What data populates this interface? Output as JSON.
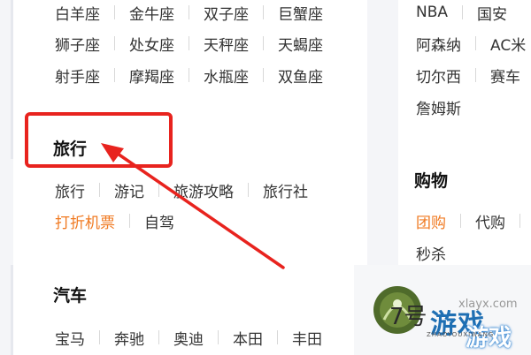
{
  "left": {
    "zodiac_rows": [
      [
        "白羊座",
        "金牛座",
        "双子座",
        "巨蟹座"
      ],
      [
        "狮子座",
        "处女座",
        "天秤座",
        "天蝎座"
      ],
      [
        "射手座",
        "摩羯座",
        "水瓶座",
        "双鱼座"
      ]
    ],
    "travel": {
      "title": "旅行",
      "row1": [
        "旅行",
        "游记",
        "旅游攻略",
        "旅行社"
      ],
      "row2": [
        "打折机票",
        "自驾"
      ]
    },
    "cars": {
      "title": "汽车",
      "row1": [
        "宝马",
        "奔驰",
        "奥迪",
        "本田",
        "丰田"
      ]
    }
  },
  "right": {
    "sports_rows": [
      [
        "NBA",
        "国安"
      ],
      [
        "阿森纳",
        "AC米"
      ],
      [
        "切尔西",
        "赛车"
      ],
      [
        "詹姆斯"
      ]
    ],
    "shopping": {
      "title": "购物",
      "row1": [
        "团购",
        "代购"
      ],
      "row2": [
        "秒杀"
      ]
    }
  },
  "watermark": {
    "number": "7号",
    "brand": "游戏",
    "brand_small": "游戏",
    "site": "xlayx.com",
    "pinyin": "ZHAOYOUXIWANG"
  },
  "colors": {
    "highlight": "#e8231e",
    "link_orange": "#f07a22"
  }
}
